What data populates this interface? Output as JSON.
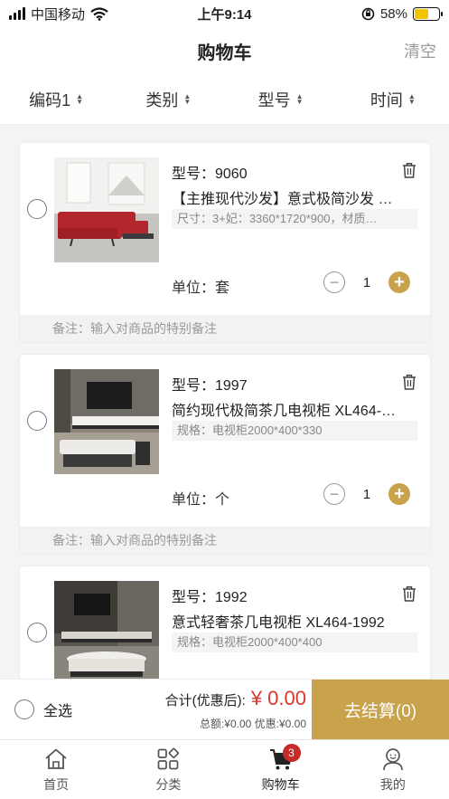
{
  "status_bar": {
    "carrier": "中国移动",
    "time": "上午9:14",
    "battery": "58%",
    "battery_level": 0.58
  },
  "header": {
    "title": "购物车",
    "clear_label": "清空"
  },
  "sort_options": [
    {
      "label": "编码1"
    },
    {
      "label": "类别"
    },
    {
      "label": "型号"
    },
    {
      "label": "时间"
    }
  ],
  "items": [
    {
      "model": "型号：9060",
      "title": "【主推现代沙发】意式极简沙发 …",
      "spec": "尺寸：3+妃：3360*1720*900，材质…",
      "unit": "单位：套",
      "quantity": "1",
      "remark_placeholder": "备注：输入对商品的特别备注",
      "image": "red-sofa"
    },
    {
      "model": "型号：1997",
      "title": "简约现代极简茶几电视柜 XL464-…",
      "spec": "规格：电视柜2000*400*330",
      "unit": "单位：个",
      "quantity": "1",
      "remark_placeholder": "备注：输入对商品的特别备注",
      "image": "tv-cabinet"
    },
    {
      "model": "型号：1992",
      "title": "意式轻奢茶几电视柜 XL464-1992",
      "spec": "规格：电视柜2000*400*400",
      "image": "tv-cabinet-dark"
    }
  ],
  "checkout": {
    "select_all_label": "全选",
    "total_label": "合计(优惠后):",
    "total_value": "¥ 0.00",
    "detail": "总额:¥0.00 优惠:¥0.00",
    "submit_label": "去结算(0)"
  },
  "tabs": [
    {
      "label": "首页",
      "icon": "home-icon"
    },
    {
      "label": "分类",
      "icon": "category-icon"
    },
    {
      "label": "购物车",
      "icon": "cart-icon",
      "badge": "3"
    },
    {
      "label": "我的",
      "icon": "profile-icon"
    }
  ],
  "colors": {
    "accent": "#c9a24c",
    "price": "#d8372c",
    "badge": "#c62b27"
  }
}
